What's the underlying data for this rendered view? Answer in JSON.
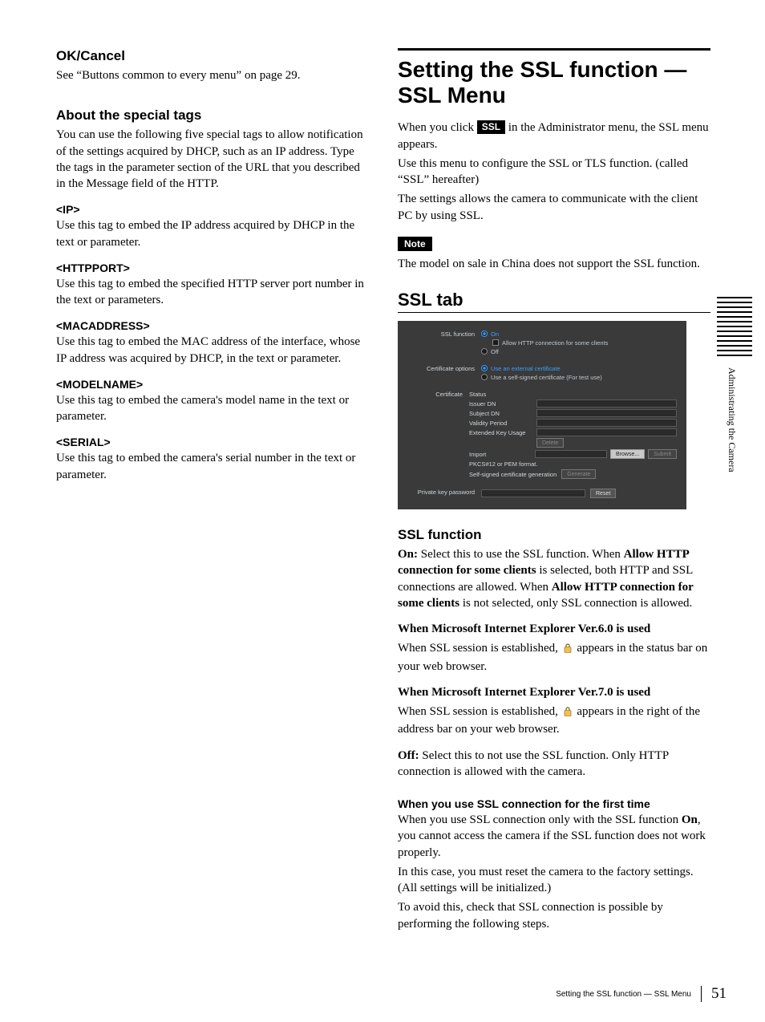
{
  "left": {
    "ok_cancel": {
      "heading": "OK/Cancel",
      "body": "See “Buttons common to every menu” on page 29."
    },
    "special_tags": {
      "heading": "About the special tags",
      "intro": "You can use the following five special tags to allow notification of the settings acquired by DHCP, such as an IP address. Type the tags in the parameter section of the URL that you described in the Message field of the HTTP.",
      "items": [
        {
          "tag": "<IP>",
          "desc": "Use this tag to embed the IP address acquired by DHCP in the text or parameter."
        },
        {
          "tag": "<HTTPPORT>",
          "desc": "Use this tag to embed the specified HTTP server port number in the text or parameters."
        },
        {
          "tag": "<MACADDRESS>",
          "desc": "Use this tag to embed the MAC address of the interface, whose IP address was acquired by DHCP, in the text or parameter."
        },
        {
          "tag": "<MODELNAME>",
          "desc": "Use this tag to embed the camera's model name in the text or parameter."
        },
        {
          "tag": "<SERIAL>",
          "desc": "Use this tag to embed the camera's serial number in the text or parameter."
        }
      ]
    }
  },
  "right": {
    "title": "Setting the SSL function — SSL Menu",
    "intro_prefix": "When you click ",
    "intro_pill": "SSL",
    "intro_suffix": " in the Administrator menu, the SSL menu appears.",
    "intro2": "Use this menu to configure the SSL or TLS function. (called “SSL” hereafter)",
    "intro3": "The settings allows the camera to communicate with the client PC by using SSL.",
    "note_label": "Note",
    "note_body": "The model on sale in China does not support the SSL function.",
    "ssl_tab_heading": "SSL tab",
    "shot": {
      "ssl_function_label": "SSL function",
      "on": "On",
      "allow_http": "Allow HTTP connection for some clients",
      "off": "Off",
      "cert_options_label": "Certificate options",
      "use_external": "Use an external certificate",
      "use_selfsigned": "Use a self-signed certificate (For test use)",
      "certificate_label": "Certificate",
      "status": "Status",
      "issuer_dn": "Issuer DN",
      "subject_dn": "Subject DN",
      "validity_period": "Validity Period",
      "extended_key": "Extended Key Usage",
      "delete": "Delete",
      "import": "Import",
      "browse": "Browse...",
      "submit": "Submit",
      "pkcs_hint": "PKCS#12 or PEM format.",
      "selfgen": "Self-signed certificate generation",
      "generate": "Generate",
      "pk_label": "Private key password",
      "reset": "Reset"
    },
    "ssl_function_heading": "SSL function",
    "on_label": "On:",
    "on_body_1": " Select this to use the SSL function. When ",
    "on_bold_1": "Allow HTTP connection for some clients",
    "on_body_2": " is selected, both HTTP and SSL connections are allowed. When ",
    "on_bold_2": "Allow HTTP connection for some clients",
    "on_body_3": " is not selected, only SSL connection is allowed.",
    "ie6_h": "When Microsoft Internet Explorer Ver.6.0 is used",
    "ie6_b_pre": "When SSL session is established, ",
    "ie6_b_post": " appears in the status bar on your web browser.",
    "ie7_h": "When Microsoft Internet Explorer Ver.7.0 is used",
    "ie7_b_pre": "When SSL session is established, ",
    "ie7_b_post": " appears in the right of the address bar on your web browser.",
    "off_label": "Off:",
    "off_body": " Select this to not use the SSL function. Only HTTP connection is allowed with the camera.",
    "first_time_h": "When you use SSL connection for the first time",
    "first_time_b1_pre": "When you use SSL connection only with the SSL function ",
    "first_time_b1_bold": "On",
    "first_time_b1_post": ", you cannot access the camera if the SSL function does not work properly.",
    "first_time_b2": "In this case, you must reset the camera to the factory settings. (All settings will be initialized.)",
    "first_time_b3": "To avoid this, check that SSL connection is possible by performing the following steps."
  },
  "side_tab": "Administrating the Camera",
  "footer": {
    "caption": "Setting the SSL function — SSL Menu",
    "page_number": "51"
  }
}
